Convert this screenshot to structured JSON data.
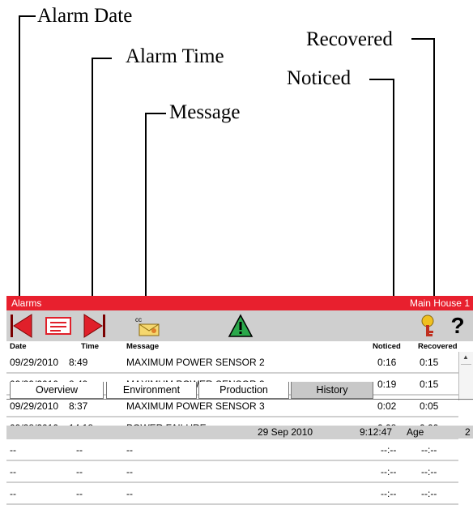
{
  "callouts": {
    "alarm_date": "Alarm Date",
    "alarm_time": "Alarm Time",
    "message": "Message",
    "recovered": "Recovered",
    "noticed": "Noticed"
  },
  "window": {
    "title": "Alarms",
    "location": "Main House 1"
  },
  "toolbar": {
    "icons": [
      "previous-arrow-icon",
      "alarm-list-icon",
      "next-arrow-icon",
      "message-envelope-icon",
      "warning-triangle-icon",
      "key-icon",
      "help-icon"
    ],
    "help_label": "?",
    "cc_label": "cc"
  },
  "table": {
    "headers": {
      "date": "Date",
      "time": "Time",
      "message": "Message",
      "noticed": "Noticed",
      "recovered": "Recovered"
    },
    "rows": [
      {
        "date": "09/29/2010",
        "time": "8:49",
        "message": "MAXIMUM POWER SENSOR  2",
        "noticed": "0:16",
        "recovered": "0:15"
      },
      {
        "date": "09/29/2010",
        "time": "8:49",
        "message": "MAXIMUM POWER SENSOR  3",
        "noticed": "0:19",
        "recovered": "0:15"
      },
      {
        "date": "09/29/2010",
        "time": "8:37",
        "message": "MAXIMUM POWER SENSOR  3",
        "noticed": "0:02",
        "recovered": "0:05"
      },
      {
        "date": "09/28/2010",
        "time": "14:18",
        "message": "POWER FAILURE",
        "noticed": "0:08",
        "recovered": "0:00"
      },
      {
        "date": "--",
        "time": "--",
        "message": "--",
        "noticed": "--:--",
        "recovered": "--:--"
      },
      {
        "date": "--",
        "time": "--",
        "message": "--",
        "noticed": "--:--",
        "recovered": "--:--"
      },
      {
        "date": "--",
        "time": "--",
        "message": "--",
        "noticed": "--:--",
        "recovered": "--:--"
      }
    ]
  },
  "tabs": [
    "Overview",
    "Environment",
    "Production",
    "History"
  ],
  "active_tab": "History",
  "status": {
    "date": "29 Sep 2010",
    "time": "9:12:47",
    "age_label": "Age",
    "age_value": "2"
  },
  "colors": {
    "titlebar": "#e8202e",
    "arrow_red": "#e0202a",
    "warning_green": "#2aa84a"
  }
}
